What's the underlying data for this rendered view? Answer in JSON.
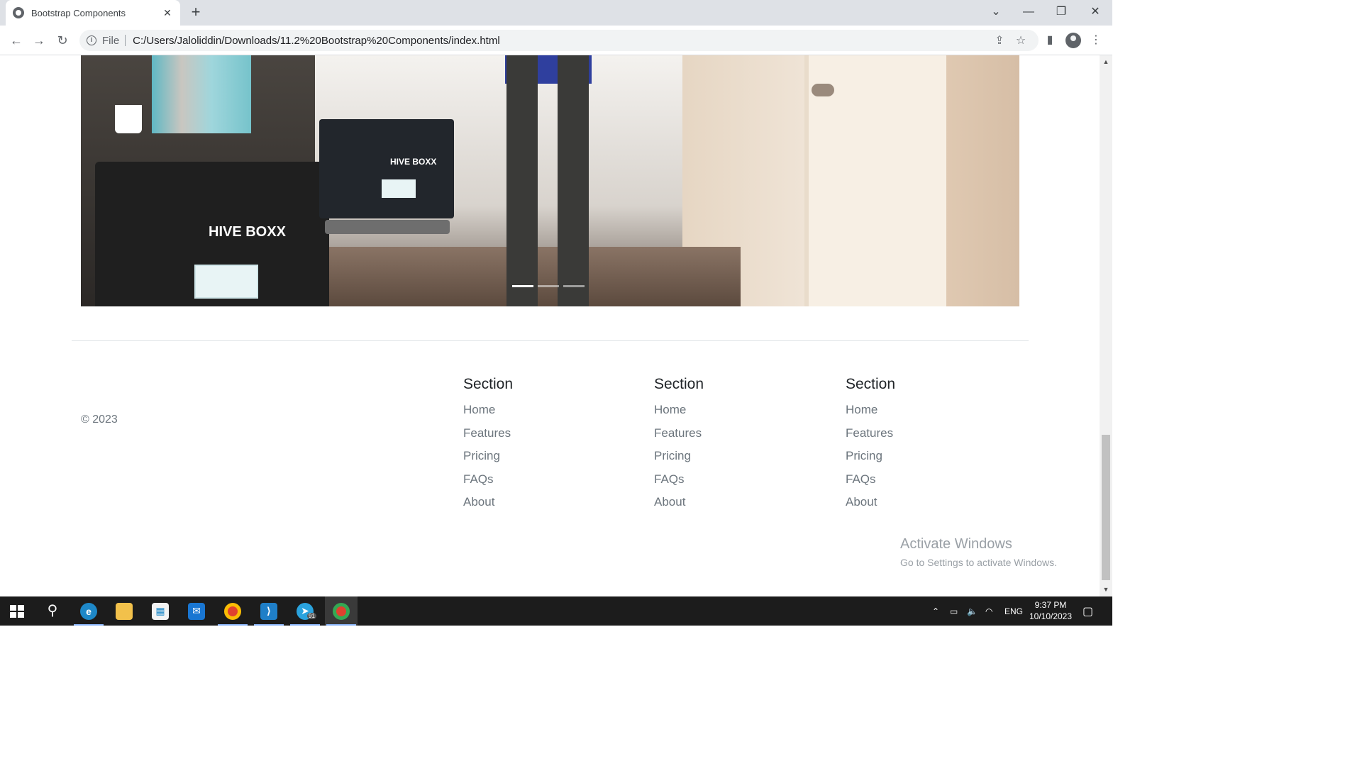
{
  "browser": {
    "tab_title": "Bootstrap Components",
    "tab_close": "✕",
    "new_tab": "+",
    "url_scheme": "File",
    "url": "C:/Users/Jaloliddin/Downloads/11.2%20Bootstrap%20Components/index.html"
  },
  "carousel": {
    "crate_brand_large": "HIVE BOXX",
    "crate_brand_small": "HIVE BOXX",
    "active_slide_index": 0,
    "slide_count": 3
  },
  "footer": {
    "copyright": "© 2023",
    "columns": [
      {
        "heading": "Section",
        "links": [
          "Home",
          "Features",
          "Pricing",
          "FAQs",
          "About"
        ]
      },
      {
        "heading": "Section",
        "links": [
          "Home",
          "Features",
          "Pricing",
          "FAQs",
          "About"
        ]
      },
      {
        "heading": "Section",
        "links": [
          "Home",
          "Features",
          "Pricing",
          "FAQs",
          "About"
        ]
      }
    ]
  },
  "watermark": {
    "line1": "Activate Windows",
    "line2": "Go to Settings to activate Windows."
  },
  "taskbar": {
    "tray_lang": "ENG",
    "time": "9:37 PM",
    "date": "10/10/2023",
    "telegram_badge": "91"
  },
  "colors": {
    "taskbar": "#1c1c1c",
    "chrome_frame": "#dee1e6",
    "link_text": "#6c757d",
    "heading_text": "#212529"
  }
}
